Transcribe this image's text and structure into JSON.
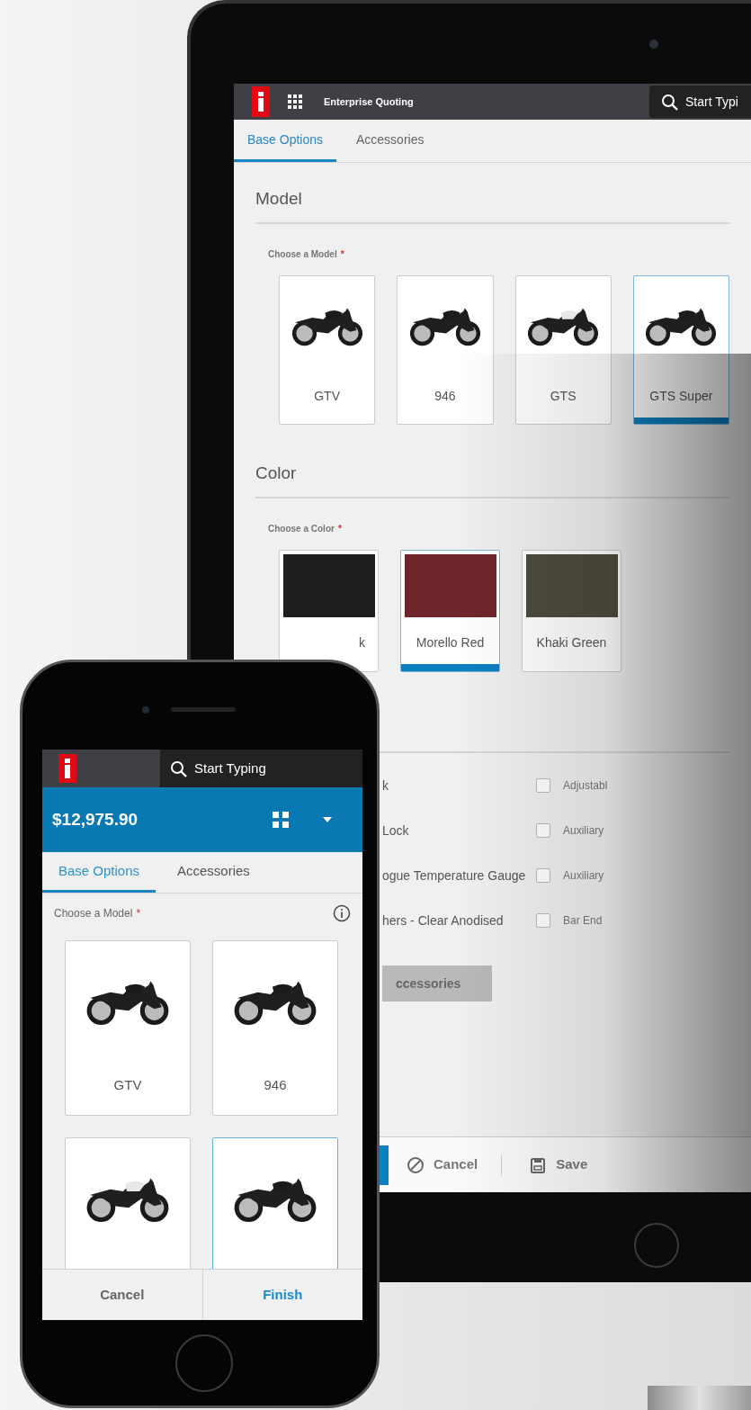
{
  "tablet": {
    "app_title": "Enterprise Quoting",
    "search": {
      "placeholder": "Start Typi"
    },
    "tabs": [
      {
        "label": "Base Options",
        "selected": true
      },
      {
        "label": "Accessories",
        "selected": false
      }
    ],
    "model_section": {
      "heading": "Model",
      "field_label": "Choose a Model",
      "required": true,
      "required_mark": "*",
      "models": [
        {
          "name": "GTV",
          "selected": false
        },
        {
          "name": "946",
          "selected": false
        },
        {
          "name": "GTS",
          "selected": false
        },
        {
          "name": "GTS Super",
          "selected": true
        }
      ]
    },
    "color_section": {
      "heading": "Color",
      "field_label": "Choose a Color",
      "required": true,
      "required_mark": "*",
      "colors": [
        {
          "name": "k",
          "color": "#1e1e1e",
          "selected": false
        },
        {
          "name": "Morello Red",
          "color": "#6e262c",
          "selected": true
        },
        {
          "name": "Khaki Green",
          "color": "#4c4b3c",
          "selected": false
        }
      ]
    },
    "accessories": {
      "left_items": [
        "k",
        "Lock",
        "ogue Temperature Gauge",
        "hers - Clear Anodised"
      ],
      "right_items": [
        {
          "label": "Adjustabl",
          "checked": false
        },
        {
          "label": "Auxiliary",
          "checked": false
        },
        {
          "label": "Auxiliary",
          "checked": false
        },
        {
          "label": "Bar End",
          "checked": false
        }
      ],
      "button": "ccessories"
    },
    "footer": {
      "actions": [
        {
          "label": "Cancel",
          "kind": "cancel"
        },
        {
          "label": "Save",
          "kind": "save"
        }
      ]
    }
  },
  "phone": {
    "search": {
      "placeholder": "Start Typing"
    },
    "price": "$12,975.90",
    "tabs": [
      {
        "label": "Base Options",
        "selected": true
      },
      {
        "label": "Accessories",
        "selected": false
      }
    ],
    "field_label": "Choose a Model",
    "required": true,
    "required_mark": "*",
    "models": [
      {
        "name": "GTV",
        "selected": false
      },
      {
        "name": "946",
        "selected": false
      },
      {
        "selected": false
      },
      {
        "selected": true
      }
    ],
    "footer": [
      {
        "label": "Cancel",
        "kind": "cancel"
      },
      {
        "label": "Finish",
        "kind": "primary"
      }
    ]
  }
}
